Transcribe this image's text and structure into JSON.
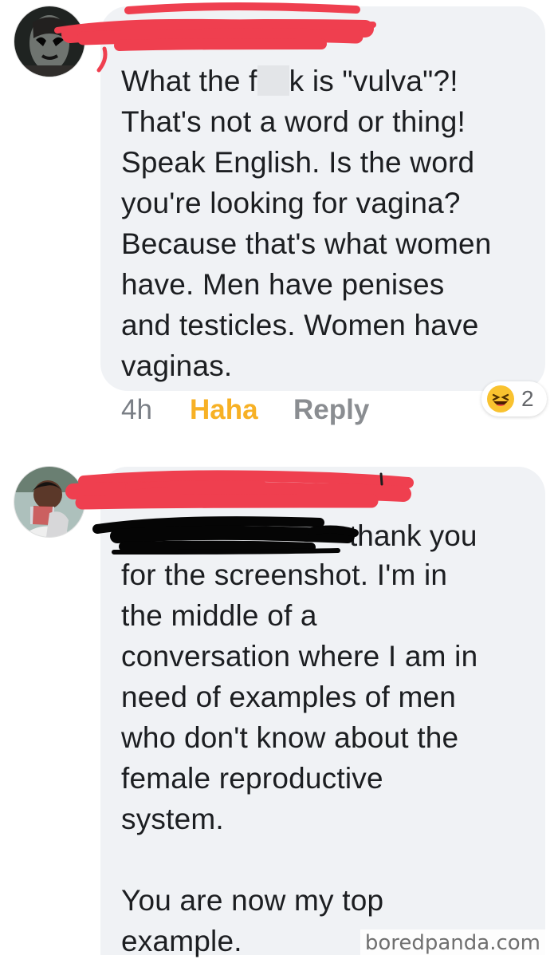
{
  "comments": [
    {
      "timestamp": "4h",
      "text_before_gap": "What the f",
      "text_after_gap": "k is \"vulva\"?!\nThat's not a word or thing!\nSpeak English. Is the word\nyou're looking for vagina?\nBecause that's what women\nhave. Men have penises\nand testicles. Women have\nvaginas.",
      "haha_label": "Haha",
      "reply_label": "Reply",
      "reaction_icon": "laughing-emoji-icon",
      "reaction_count": "2"
    },
    {
      "first_line_visible": "thank you",
      "text": "for the screenshot. I'm in\nthe middle of a\nconversation where I am in\nneed of examples of men\nwho don't know  about the\nfemale reproductive\nsystem.\n\nYou are now my top\nexample."
    }
  ],
  "watermark": "boredpanda.com",
  "colors": {
    "bubble_background": "#f0f2f5",
    "haha_color": "#f7b125",
    "reply_color": "#8a8d91",
    "red_redaction": "#ef3f4f",
    "black_redaction": "#050505"
  }
}
